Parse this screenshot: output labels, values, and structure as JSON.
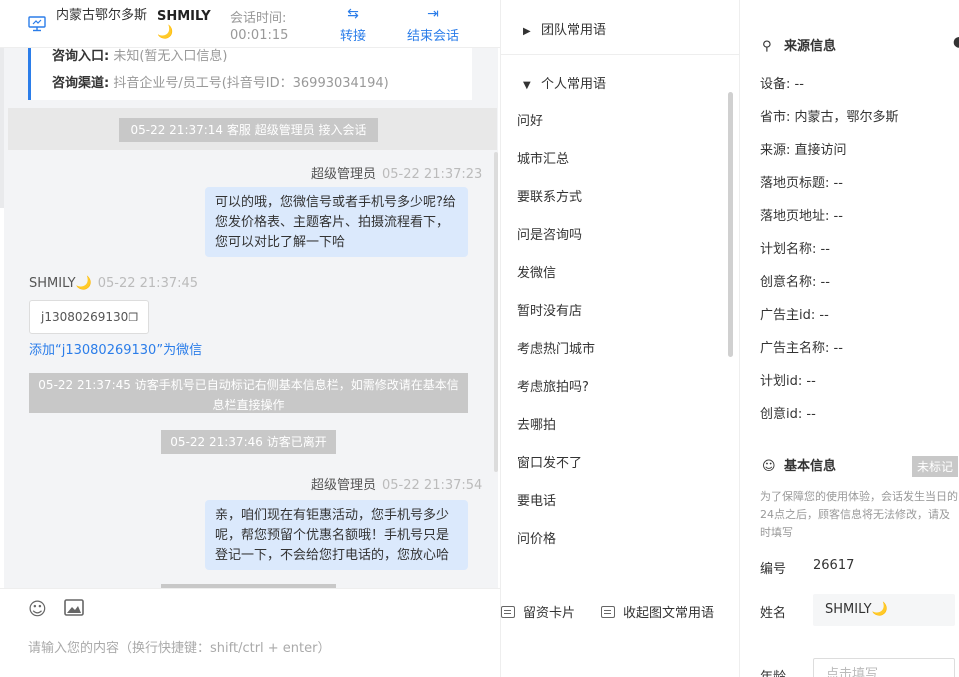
{
  "header": {
    "location": "内蒙古鄂尔多斯",
    "visitor_name": "SHMILY",
    "moon": "🌙",
    "session_time_label": "会话时间:",
    "session_time": "00:01:15",
    "transfer_label": "转接",
    "end_label": "结束会话"
  },
  "info_card": {
    "entry_label": "咨询入口:",
    "entry_value": "未知(暂无入口信息)",
    "channel_label": "咨询渠道:",
    "channel_value": "抖音企业号/员工号(抖音号ID：36993034194)"
  },
  "messages": {
    "sys1": "05-22 21:37:14 客服 超级管理员 接入会话",
    "m1_name": "超级管理员",
    "m1_time": "05-22 21:37:23",
    "m1_text": "可以的哦，您微信号或者手机号多少呢?给您发价格表、主题客片、拍摄流程看下，您可以对比了解一下哈",
    "m2_name": "SHMILY🌙",
    "m2_time": "05-22 21:37:45",
    "m2_text": "j13080269130",
    "add_wechat": "添加“j13080269130”为微信",
    "sys2": "05-22 21:37:45 访客手机号已自动标记右侧基本信息栏，如需修改请在基本信息栏直接操作",
    "sys3": "05-22 21:37:46 访客已离开",
    "m3_name": "超级管理员",
    "m3_time": "05-22 21:37:54",
    "m3_text": "亲，咱们现在有钜惠活动，您手机号多少呢，帮您预留个优惠名额哦！手机号只是登记一下，不会给您打电话的，您放心哈"
  },
  "footer": {
    "input_placeholder": "请输入您的内容（换行快捷键：shift/ctrl + enter）"
  },
  "phrases": {
    "team_group": "团队常用语",
    "personal_group": "个人常用语",
    "items": [
      "问好",
      "城市汇总",
      "要联系方式",
      "问是咨询吗",
      "发微信",
      "暂时没有店",
      "考虑热门城市",
      "考虑旅拍吗?",
      "去哪拍",
      "窗口发不了",
      "要电话",
      "问价格"
    ],
    "card_btn": "留资卡片",
    "collapse_btn": "收起图文常用语"
  },
  "source_info": {
    "title": "来源信息",
    "rows": [
      "设备: --",
      "省市: 内蒙古，鄂尔多斯",
      "来源: 直接访问",
      "落地页标题: --",
      "落地页地址: --",
      "计划名称: --",
      "创意名称: --",
      "广告主id: --",
      "广告主名称: --",
      "计划id: --",
      "创意id: --"
    ]
  },
  "basic_info": {
    "title": "基本信息",
    "badge": "未标记",
    "notice": "为了保障您的使用体验，会话发生当日的24点之后，顾客信息将无法修改，请及时填写",
    "id_label": "编号",
    "id_value": "26617",
    "name_label": "姓名",
    "name_value": "SHMILY🌙",
    "age_label": "年龄",
    "age_placeholder": "点击填写"
  },
  "colors": {
    "accent": "#2b7de9",
    "bubble": "#dbe9fc",
    "system": "#c8c8c8"
  }
}
